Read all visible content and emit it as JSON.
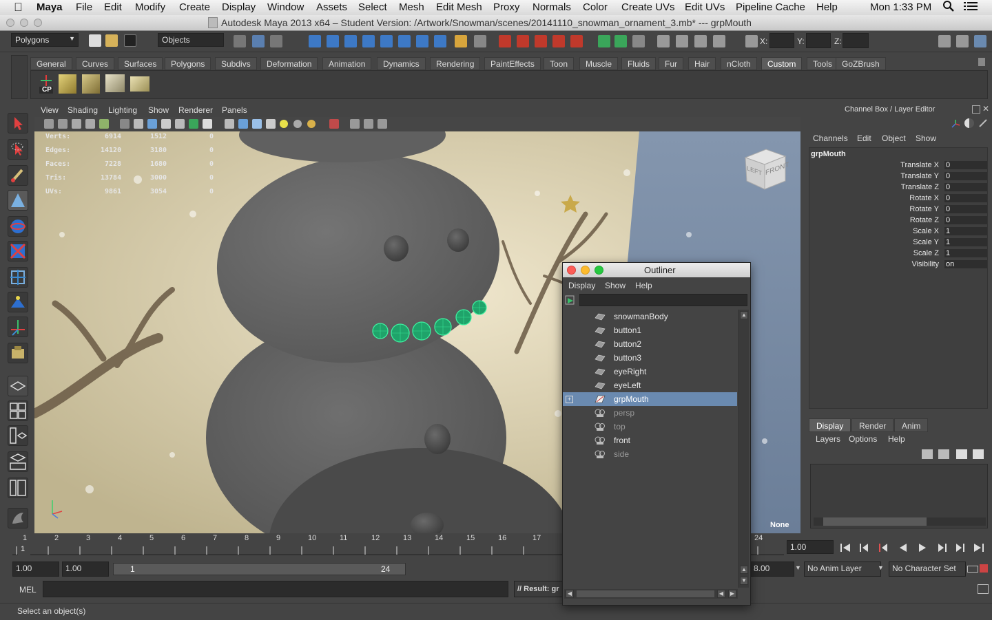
{
  "menubar": {
    "apple": "",
    "app": "Maya",
    "items": [
      "File",
      "Edit",
      "Modify",
      "Create",
      "Display",
      "Window",
      "Assets",
      "Select",
      "Mesh",
      "Edit Mesh",
      "Proxy",
      "Normals",
      "Color",
      "Create UVs",
      "Edit UVs",
      "Pipeline Cache",
      "Help"
    ],
    "clock": "Mon 1:33 PM"
  },
  "window": {
    "title": "Autodesk Maya 2013 x64 – Student Version: /Artwork/Snowman/scenes/20141110_snowman_ornament_3.mb*  ---  grpMouth"
  },
  "statusline": {
    "menuset": "Polygons",
    "selection_mode": "Objects",
    "x_label": "X:",
    "y_label": "Y:",
    "z_label": "Z:"
  },
  "shelf": {
    "tabs": [
      "General",
      "Curves",
      "Surfaces",
      "Polygons",
      "Subdivs",
      "Deformation",
      "Animation",
      "Dynamics",
      "Rendering",
      "PaintEffects",
      "Toon",
      "Muscle",
      "Fluids",
      "Fur",
      "Hair",
      "nCloth",
      "Custom",
      "Tools",
      "GoZBrush"
    ],
    "active_tab": "Custom",
    "cp_label": "CP"
  },
  "viewport": {
    "menus": [
      "View",
      "Shading",
      "Lighting",
      "Show",
      "Renderer",
      "Panels"
    ],
    "hud": [
      {
        "label": "Verts:",
        "a": "6914",
        "b": "1512",
        "c": "0"
      },
      {
        "label": "Edges:",
        "a": "14120",
        "b": "3180",
        "c": "0"
      },
      {
        "label": "Faces:",
        "a": "7228",
        "b": "1680",
        "c": "0"
      },
      {
        "label": "Tris:",
        "a": "13784",
        "b": "3000",
        "c": "0"
      },
      {
        "label": "UVs:",
        "a": "9861",
        "b": "3054",
        "c": "0"
      }
    ],
    "viewcube": {
      "left": "LEFT",
      "front": "FRONT"
    },
    "camera_label": "None"
  },
  "channelbox": {
    "header": "Channel Box / Layer Editor",
    "menus": [
      "Channels",
      "Edit",
      "Object",
      "Show"
    ],
    "object": "grpMouth",
    "attrs": [
      {
        "name": "Translate X",
        "value": "0"
      },
      {
        "name": "Translate Y",
        "value": "0"
      },
      {
        "name": "Translate Z",
        "value": "0"
      },
      {
        "name": "Rotate X",
        "value": "0"
      },
      {
        "name": "Rotate Y",
        "value": "0"
      },
      {
        "name": "Rotate Z",
        "value": "0"
      },
      {
        "name": "Scale X",
        "value": "1"
      },
      {
        "name": "Scale Y",
        "value": "1"
      },
      {
        "name": "Scale Z",
        "value": "1"
      },
      {
        "name": "Visibility",
        "value": "on"
      }
    ]
  },
  "layer_editor": {
    "tabs": [
      "Display",
      "Render",
      "Anim"
    ],
    "active_tab": "Display",
    "menus": [
      "Layers",
      "Options",
      "Help"
    ]
  },
  "timeslider": {
    "ticks": [
      "1",
      "2",
      "3",
      "4",
      "5",
      "6",
      "7",
      "8",
      "9",
      "10",
      "11",
      "12",
      "13",
      "14",
      "15",
      "16",
      "17",
      "24"
    ],
    "current_frame": "1",
    "current_time": "1.00"
  },
  "range": {
    "start": "1.00",
    "playback_start": "1.00",
    "range_start": "1",
    "range_end": "24",
    "end": "8.00",
    "anim_layer": "No Anim Layer",
    "character_set": "No Character Set"
  },
  "commandline": {
    "label": "MEL",
    "result": "// Result: gr"
  },
  "helpline": {
    "text": "Select an object(s)"
  },
  "outliner": {
    "title": "Outliner",
    "menus": [
      "Display",
      "Show",
      "Help"
    ],
    "items": [
      {
        "label": "snowmanBody",
        "state": "normal"
      },
      {
        "label": "button1",
        "state": "normal"
      },
      {
        "label": "button2",
        "state": "normal"
      },
      {
        "label": "button3",
        "state": "normal"
      },
      {
        "label": "eyeRight",
        "state": "normal"
      },
      {
        "label": "eyeLeft",
        "state": "normal"
      },
      {
        "label": "grpMouth",
        "state": "selected"
      },
      {
        "label": "persp",
        "state": "dim"
      },
      {
        "label": "top",
        "state": "dim"
      },
      {
        "label": "front",
        "state": "normal"
      },
      {
        "label": "side",
        "state": "dim"
      }
    ]
  },
  "colors": {
    "selection": "#6a8ab0",
    "highlight_green": "#3ef0a0",
    "snowman_grey": "#6e6e6e"
  }
}
